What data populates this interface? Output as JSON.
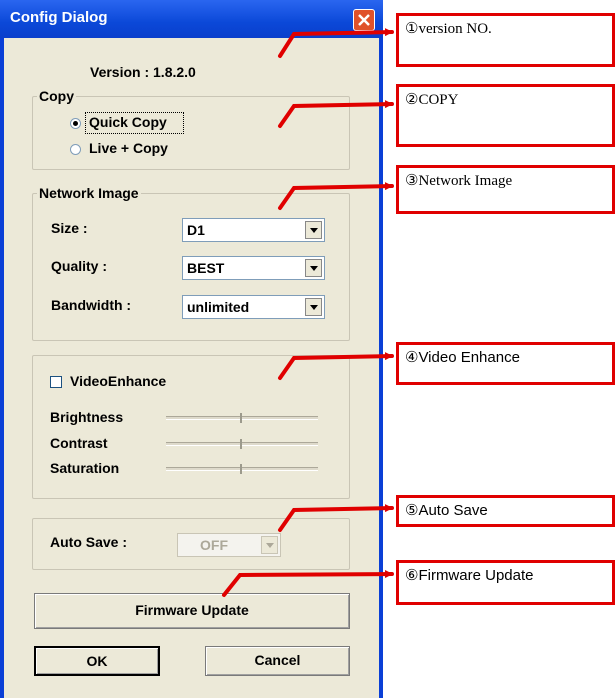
{
  "dialog": {
    "title": "Config Dialog",
    "version_text": "Version  : 1.8.2.0",
    "copy_group": {
      "legend": "Copy",
      "options": [
        "Quick Copy",
        "Live + Copy"
      ],
      "selected": "Quick Copy"
    },
    "network_group": {
      "legend": "Network Image",
      "size_label": "Size  :",
      "size_value": "D1",
      "quality_label": "Quality :",
      "quality_value": "BEST",
      "bandwidth_label": "Bandwidth :",
      "bandwidth_value": "unlimited"
    },
    "video_group": {
      "checkbox_label": "VideoEnhance",
      "checked": false,
      "brightness_label": "Brightness",
      "contrast_label": "Contrast",
      "saturation_label": "Saturation"
    },
    "auto_save": {
      "label": "Auto Save :",
      "value": "OFF",
      "disabled": true
    },
    "firmware_button": "Firmware Update",
    "ok_button": "OK",
    "cancel_button": "Cancel"
  },
  "callouts": [
    {
      "text": "①version NO."
    },
    {
      "text": "②COPY"
    },
    {
      "text": "③Network Image"
    },
    {
      "text": "④Video Enhance"
    },
    {
      "text": "⑤Auto Save"
    },
    {
      "text": "⑥Firmware Update"
    }
  ],
  "colors": {
    "callout_border": "#e00000",
    "titlebar": "#0b48d8",
    "dialog_face": "#ece9d8"
  }
}
